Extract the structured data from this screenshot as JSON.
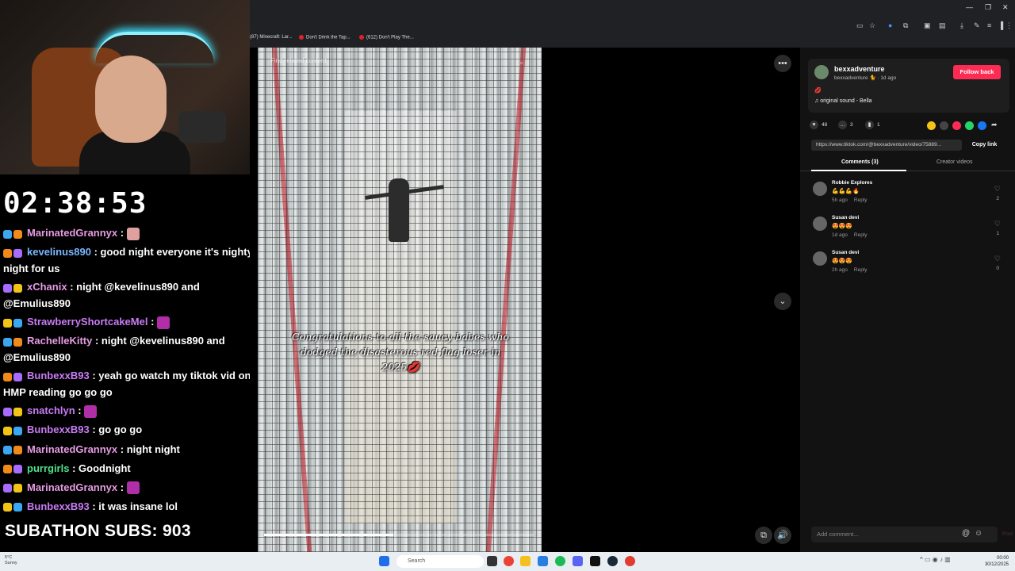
{
  "overlay": {
    "timer": "02:38:53",
    "subathon": "SUBATHON SUBS: 903",
    "chat": [
      {
        "user": "MarinatedGrannyx",
        "color": "#e79be4",
        "text": " : ",
        "emote": "pink"
      },
      {
        "user": "kevelinus890",
        "color": "#7ab7ff",
        "text": " : good night everyone it's nighty night for us"
      },
      {
        "user": "xChanix",
        "color": "#e79be4",
        "text": " : night @kevelinus890 and @Emulius890"
      },
      {
        "user": "StrawberryShortcakeMel",
        "color": "#c97cf5",
        "text": " : ",
        "emote": "purple"
      },
      {
        "user": "RachelleKitty",
        "color": "#e79be4",
        "text": " : night @kevelinus890 and @Emulius890"
      },
      {
        "user": "BunbexxB93",
        "color": "#c97cf5",
        "text": " : yeah go watch my tiktok vid on HMP reading go go go"
      },
      {
        "user": "snatchlyn",
        "color": "#c97cf5",
        "text": " : ",
        "emote": "purple"
      },
      {
        "user": "BunbexxB93",
        "color": "#c97cf5",
        "text": " : go go go"
      },
      {
        "user": "MarinatedGrannyx",
        "color": "#e79be4",
        "text": " : night night"
      },
      {
        "user": "purrgirls",
        "color": "#4fe08a",
        "text": " : Goodnight"
      },
      {
        "user": "MarinatedGrannyx",
        "color": "#e79be4",
        "text": " : ",
        "emote": "purple"
      },
      {
        "user": "BunbexxB93",
        "color": "#c97cf5",
        "text": " : it was insane lol"
      }
    ]
  },
  "browser": {
    "tabs": [
      "(87) Minecraft: Lar...",
      "Don't Drink the Tap...",
      "(612) Don't Play The..."
    ],
    "video": {
      "search_placeholder": "Find related content",
      "caption": "Congratulations to all the saucy babes who dodged the disasterous red flag loser in 2025💋",
      "progress": 0.48
    },
    "panel": {
      "creator_name": "bexxadventure",
      "creator_sub": "bexxadventure 🐈 · 1d ago",
      "follow_label": "Follow back",
      "desc": "💋",
      "sound": "♫  original sound - Bella",
      "likes": "48",
      "comments_count": "3",
      "saves": "1",
      "url": "https://www.tiktok.com/@bexxadventure/video/75889...",
      "copy_link": "Copy link",
      "tab_comments": "Comments (3)",
      "tab_creator": "Creator videos",
      "comments": [
        {
          "name": "Robbie Explores",
          "text": "💪💪💪🔥",
          "time": "5h ago",
          "reply": "Reply",
          "likes": "2"
        },
        {
          "name": "Susan devi",
          "text": "😍😍😍",
          "time": "1d ago",
          "reply": "Reply",
          "likes": "1"
        },
        {
          "name": "Susan devi",
          "text": "😍😍😍",
          "time": "2h ago",
          "reply": "Reply",
          "likes": "0"
        }
      ],
      "add_comment_placeholder": "Add comment...",
      "post_label": "Post"
    }
  },
  "taskbar": {
    "weather_temp": "5°C",
    "weather_desc": "Sunny",
    "search": "Search",
    "time": "00:00",
    "date": "30/12/2025"
  }
}
